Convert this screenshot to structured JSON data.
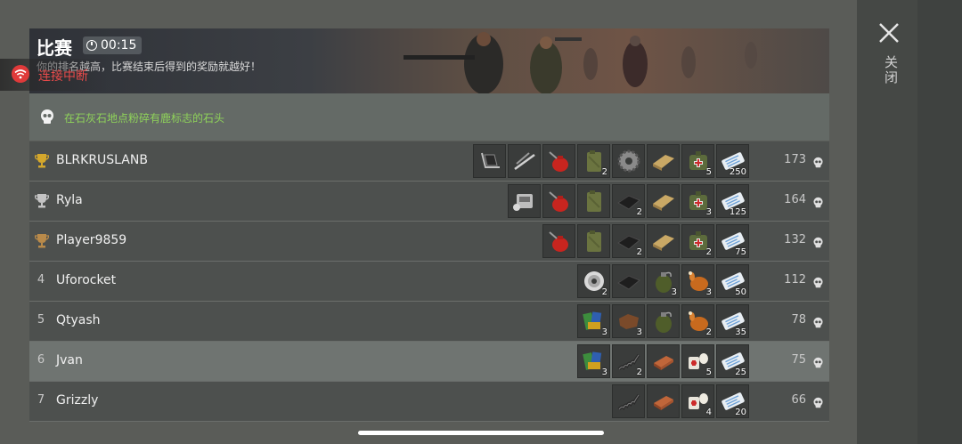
{
  "header": {
    "title": "比赛",
    "timer": "00:15",
    "subtitle": "你的排名越高，比赛结束后得到的奖励就越好！"
  },
  "connection": {
    "status_text": "连接中断"
  },
  "mission": {
    "text": "在石灰石地点粉碎有鹿标志的石头"
  },
  "close_label": "关闭",
  "rows": [
    {
      "rank": "",
      "trophy": "gold",
      "name": "BLRKRUSLANB",
      "score": "173",
      "items": [
        {
          "icon": "sled-icon",
          "count": ""
        },
        {
          "icon": "pipes-icon",
          "count": ""
        },
        {
          "icon": "oil-can-icon",
          "count": ""
        },
        {
          "icon": "jerrycan-icon",
          "count": "2"
        },
        {
          "icon": "gear-icon",
          "count": ""
        },
        {
          "icon": "plank-icon",
          "count": ""
        },
        {
          "icon": "medkit-bag-icon",
          "count": "5"
        },
        {
          "icon": "ticket-icon",
          "count": "250"
        }
      ]
    },
    {
      "rank": "",
      "trophy": "silver",
      "name": "Ryla",
      "score": "164",
      "items": [
        {
          "icon": "engine-icon",
          "count": ""
        },
        {
          "icon": "oil-can-icon",
          "count": ""
        },
        {
          "icon": "jerrycan-icon",
          "count": ""
        },
        {
          "icon": "fabric-icon",
          "count": "2"
        },
        {
          "icon": "plank-icon",
          "count": ""
        },
        {
          "icon": "medkit-bag-icon",
          "count": "3"
        },
        {
          "icon": "ticket-icon",
          "count": "125"
        }
      ]
    },
    {
      "rank": "",
      "trophy": "bronze",
      "name": "Player9859",
      "score": "132",
      "items": [
        {
          "icon": "oil-can-icon",
          "count": ""
        },
        {
          "icon": "jerrycan-icon",
          "count": ""
        },
        {
          "icon": "fabric-icon",
          "count": "2"
        },
        {
          "icon": "plank-icon",
          "count": ""
        },
        {
          "icon": "medkit-bag-icon",
          "count": "2"
        },
        {
          "icon": "ticket-icon",
          "count": "75"
        }
      ]
    },
    {
      "rank": "4",
      "trophy": "",
      "name": "Uforocket",
      "score": "112",
      "items": [
        {
          "icon": "wire-spool-icon",
          "count": "2"
        },
        {
          "icon": "fabric-icon",
          "count": ""
        },
        {
          "icon": "grenade-icon",
          "count": "3"
        },
        {
          "icon": "roast-chicken-icon",
          "count": "3"
        },
        {
          "icon": "ticket-icon",
          "count": "50"
        }
      ]
    },
    {
      "rank": "5",
      "trophy": "",
      "name": "Qtyash",
      "score": "78",
      "items": [
        {
          "icon": "books-icon",
          "count": "3"
        },
        {
          "icon": "leather-icon",
          "count": "3"
        },
        {
          "icon": "grenade-icon",
          "count": ""
        },
        {
          "icon": "roast-chicken-icon",
          "count": "2"
        },
        {
          "icon": "ticket-icon",
          "count": "35"
        }
      ]
    },
    {
      "rank": "6",
      "trophy": "",
      "name": "Jvan",
      "score": "75",
      "highlight": true,
      "items": [
        {
          "icon": "books-icon",
          "count": "3"
        },
        {
          "icon": "spring-icon",
          "count": "2"
        },
        {
          "icon": "copper-ingot-icon",
          "count": ""
        },
        {
          "icon": "bandage-icon",
          "count": "5"
        },
        {
          "icon": "ticket-icon",
          "count": "25"
        }
      ]
    },
    {
      "rank": "7",
      "trophy": "",
      "name": "Grizzly",
      "score": "66",
      "items": [
        {
          "icon": "spring-icon",
          "count": ""
        },
        {
          "icon": "copper-ingot-icon",
          "count": ""
        },
        {
          "icon": "bandage-icon",
          "count": "4"
        },
        {
          "icon": "ticket-icon",
          "count": "20"
        }
      ]
    }
  ],
  "colors": {
    "mission_text": "#8fd35a",
    "disconnect": "#e84a4a",
    "gold": "#d4a72c",
    "silver": "#c4c4c4",
    "bronze": "#b98a4a"
  }
}
